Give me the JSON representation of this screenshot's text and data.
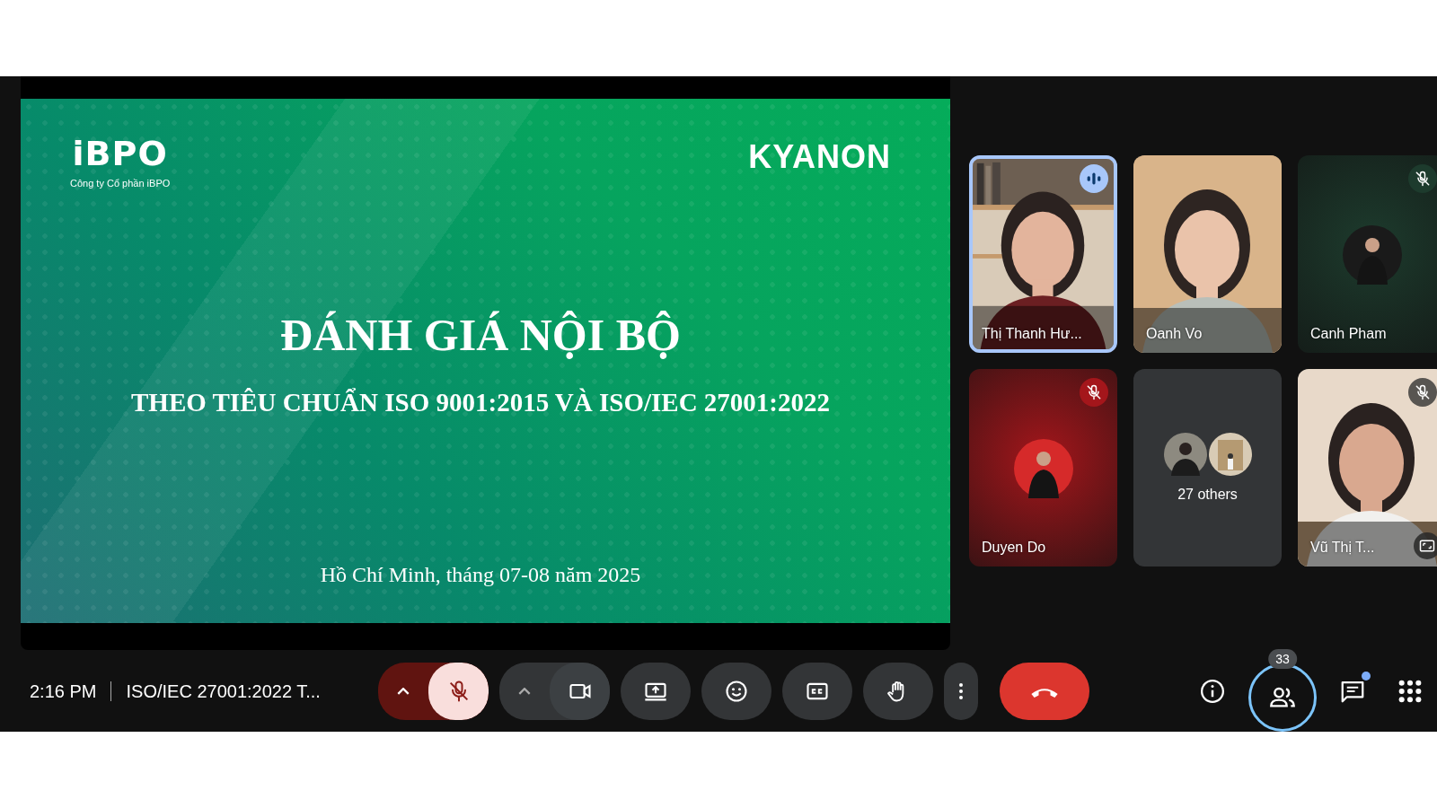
{
  "slide": {
    "logo_left": "iBPO",
    "company": "Công ty Cổ phần iBPO",
    "logo_right": "KYANON",
    "title": "ĐÁNH GIÁ NỘI BỘ",
    "subtitle": "THEO TIÊU CHUẨN ISO 9001:2015 VÀ ISO/IEC 27001:2022",
    "footer": "Hồ Chí Minh, tháng 07-08 năm 2025"
  },
  "tiles": [
    {
      "kind": "video",
      "name": "Thị Thanh Hư...",
      "speaking": true,
      "muted": false,
      "hovered": false
    },
    {
      "kind": "video",
      "name": "Oanh Vo",
      "speaking": false,
      "muted": false,
      "hovered": false
    },
    {
      "kind": "avatar",
      "name": "Canh Pham",
      "speaking": false,
      "muted": true,
      "color": "#1d3b2d"
    },
    {
      "kind": "avatar",
      "name": "Duyen Do",
      "speaking": false,
      "muted": true,
      "color": "#a4161b"
    },
    {
      "kind": "others",
      "label": "27 others"
    },
    {
      "kind": "video",
      "name": "Vũ Thị T...",
      "speaking": false,
      "muted": true,
      "hovered": true
    }
  ],
  "toolbar": {
    "time": "2:16 PM",
    "meeting_title": "ISO/IEC 27001:2022 T...",
    "mic_muted": true,
    "camera_on": true,
    "people_count": "33",
    "chat_unread": true
  }
}
